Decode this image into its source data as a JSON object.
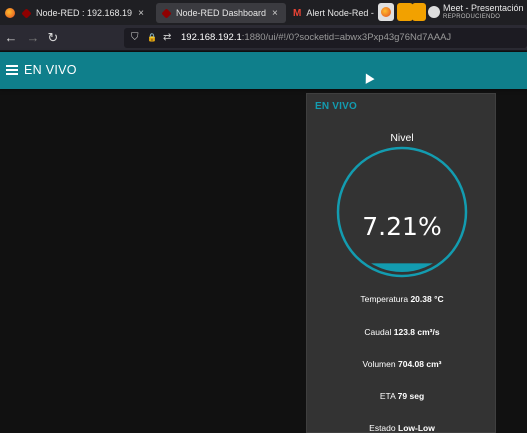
{
  "browser": {
    "tabs": [
      {
        "label": "Node-RED : 192.168.19",
        "icon": "node-red-icon",
        "active": false
      },
      {
        "label": "Node-RED Dashboard",
        "icon": "node-red-icon",
        "active": true
      },
      {
        "label": "Alert Node-Red -",
        "icon": "gmail-icon",
        "active": false
      }
    ],
    "close_glyph": "×",
    "gmail_glyph": "M",
    "meet": {
      "title": "Meet - Presentación",
      "status": "REPRODUCIENDO"
    },
    "address": {
      "host": "192.168.192.1",
      "rest": ":1880/ui/#!/0?socketid=abwx3Pxp43g76Nd7AAAJ"
    },
    "nav_glyphs": {
      "back": "←",
      "forward": "→",
      "reload": "↻",
      "shield": "⛉",
      "lock": "🔒",
      "tune": "⇄"
    }
  },
  "dashboard": {
    "header_title": "EN VIVO",
    "group": {
      "title": "EN VIVO",
      "gauge": {
        "label": "Nivel",
        "value_text": "7.21%",
        "value": 7.21,
        "min": 0,
        "max": 100,
        "ring_color": "#139cb0",
        "fill_color": "#139cb0"
      },
      "rows": [
        {
          "label": "Temperatura",
          "value": "20.38 °C"
        },
        {
          "label": "Caudal",
          "value": "123.8 cm³/s"
        },
        {
          "label": "Volumen",
          "value": "704.08 cm³"
        },
        {
          "label": "ETA",
          "value": "79 seg"
        },
        {
          "label": "Estado",
          "value": "Low-Low"
        }
      ]
    }
  },
  "colors": {
    "header_bg": "#0f7f8b",
    "accent": "#139cb0",
    "card_bg": "#333333",
    "page_bg": "#111111"
  }
}
